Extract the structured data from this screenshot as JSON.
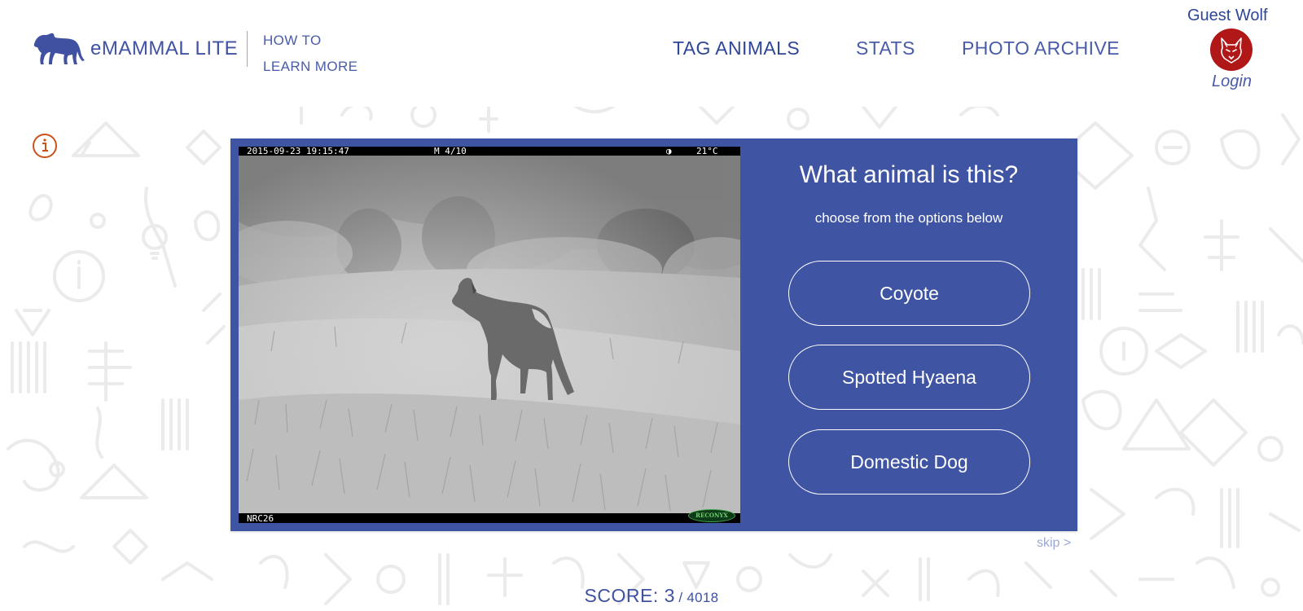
{
  "header": {
    "brand": "eMAMMAL LITE",
    "sublinks": [
      "HOW TO",
      "LEARN MORE"
    ],
    "nav": [
      "TAG ANIMALS",
      "STATS",
      "PHOTO ARCHIVE"
    ],
    "user_name": "Guest Wolf",
    "login_label": "Login"
  },
  "photo": {
    "timestamp": "2015-09-23 19:15:47",
    "frame": "M 4/10",
    "temperature": "21°C",
    "camera_id": "NRC26",
    "brand_mark": "RECONYX"
  },
  "quiz": {
    "question": "What animal is this?",
    "instruction": "choose from the options below",
    "options": [
      "Coyote",
      "Spotted Hyaena",
      "Domestic Dog"
    ]
  },
  "skip_label": "skip >",
  "score": {
    "label": "SCORE: 3",
    "total": "/ 4018"
  },
  "colors": {
    "brand_blue": "#3f54a3",
    "accent_red": "#b01818",
    "info_orange": "#c8521c",
    "pattern_gray": "#e6e6e6"
  },
  "icons": [
    "cougar-logo-icon",
    "wolf-avatar-icon",
    "info-icon"
  ]
}
